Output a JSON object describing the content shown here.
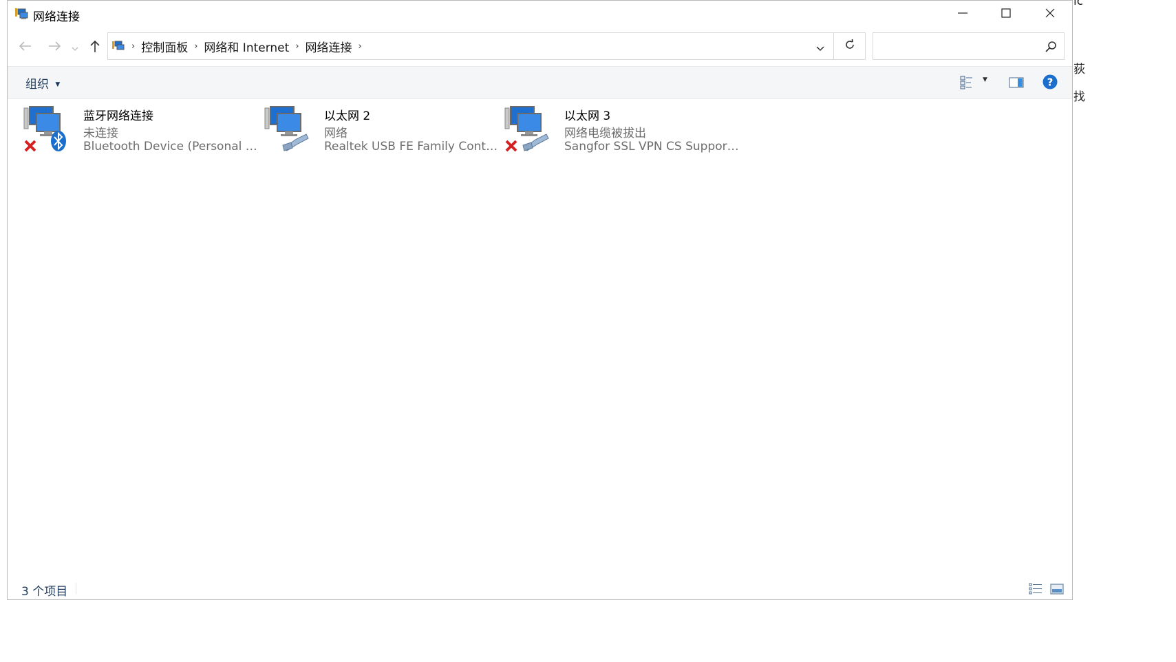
{
  "window": {
    "title": "网络连接",
    "app_icon": "network-connections-icon"
  },
  "caption_buttons": {
    "minimize": "minimize-icon",
    "maximize": "maximize-icon",
    "close": "close-icon"
  },
  "navigation": {
    "back": "back-arrow-icon",
    "forward": "forward-arrow-icon",
    "recent": "chevron-down-icon",
    "up": "up-arrow-icon"
  },
  "address": {
    "crumbs": [
      "控制面板",
      "网络和 Internet",
      "网络连接"
    ],
    "dropdown": "chevron-down-icon",
    "refresh": "refresh-icon"
  },
  "search": {
    "placeholder": "",
    "icon": "search-icon"
  },
  "toolbar": {
    "organize_label": "组织",
    "view_icon": "change-view-icon",
    "preview_icon": "preview-pane-icon",
    "help_icon": "help-icon"
  },
  "items": [
    {
      "name": "蓝牙网络连接",
      "status": "未连接",
      "device": "Bluetooth Device (Personal Are...",
      "icon": "bluetooth-network-icon"
    },
    {
      "name": "以太网 2",
      "status": "网络",
      "device": "Realtek USB FE Family Controll...",
      "icon": "ethernet-icon"
    },
    {
      "name": "以太网 3",
      "status": "网络电缆被拔出",
      "device": "Sangfor SSL VPN CS Support S...",
      "icon": "ethernet-disconnected-icon"
    }
  ],
  "statusbar": {
    "count": "3 个项目",
    "details_view": "details-view-icon",
    "large_icons_view": "large-icons-view-icon"
  },
  "behind_window": {
    "chars": [
      "ic",
      "荻",
      "找"
    ]
  },
  "colors": {
    "accent_blue": "#1e395b",
    "help_blue": "#1a6fce",
    "error_red": "#d42020"
  }
}
